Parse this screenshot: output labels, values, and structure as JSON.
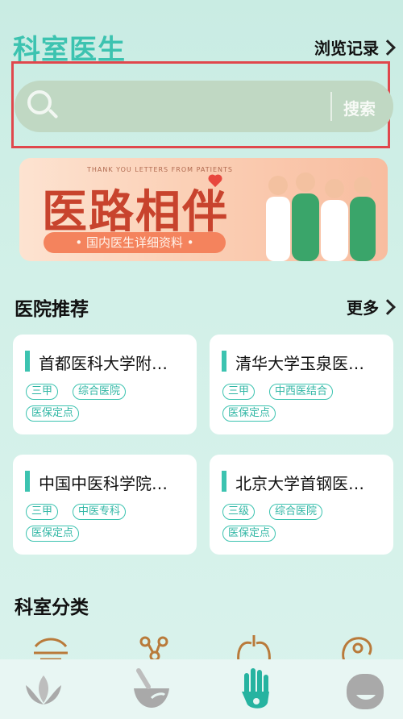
{
  "header": {
    "title": "科室医生",
    "history_label": "浏览记录"
  },
  "search": {
    "placeholder": "",
    "button_label": "搜索"
  },
  "banner": {
    "subtitle": "THANK YOU LETTERS FROM PATIENTS",
    "title": "医路相伴",
    "pill_text": "• 国内医生详细资料 •"
  },
  "hospitals": {
    "section_title": "医院推荐",
    "more_label": "更多",
    "items": [
      {
        "name": "首都医科大学附…",
        "tags": [
          "三甲",
          "综合医院",
          "医保定点"
        ]
      },
      {
        "name": "清华大学玉泉医…",
        "tags": [
          "三甲",
          "中西医结合",
          "医保定点"
        ]
      },
      {
        "name": "中国中医科学院…",
        "tags": [
          "三甲",
          "中医专科",
          "医保定点"
        ]
      },
      {
        "name": "北京大学首钢医…",
        "tags": [
          "三级",
          "综合医院",
          "医保定点"
        ]
      }
    ]
  },
  "departments": {
    "section_title": "科室分类",
    "icons": [
      "thermometer-icon",
      "molecule-icon",
      "lungs-icon",
      "brain-icon"
    ]
  },
  "tabbar": {
    "items": [
      "lotus-icon",
      "mortar-pestle-icon",
      "hand-icon",
      "face-icon"
    ],
    "active_index": 2
  },
  "colors": {
    "accent": "#3cc3b0",
    "highlight_outline": "#e0474c",
    "icon_brown": "#b97a3a"
  }
}
